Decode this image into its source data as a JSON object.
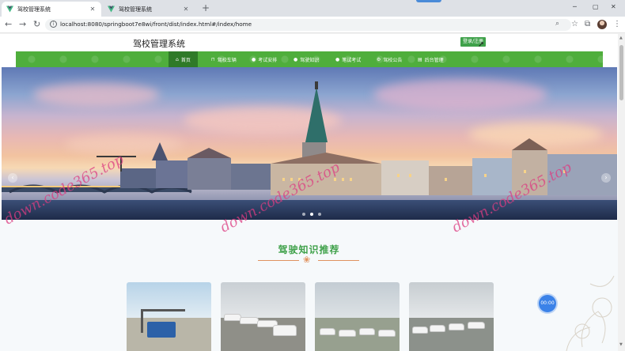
{
  "browser": {
    "tabs": [
      {
        "title": "驾校管理系统",
        "active": true
      },
      {
        "title": "驾校管理系统",
        "active": false
      }
    ],
    "url": "localhost:8080/springboot7e8wi/front/dist/index.html#/index/home",
    "icons": [
      "back-icon",
      "forward-icon",
      "reload-icon",
      "info-icon",
      "zoom-icon",
      "star-icon",
      "extensions-icon",
      "menu-icon"
    ]
  },
  "site": {
    "title": "驾校管理系统",
    "login_label": "登录/注册"
  },
  "nav": {
    "items": [
      {
        "label": "首页",
        "icon": "home-icon",
        "active": true
      },
      {
        "label": "驾校车辆",
        "icon": "car-icon",
        "active": false
      },
      {
        "label": "考试安排",
        "icon": "circle-icon",
        "active": false
      },
      {
        "label": "驾驶知识",
        "icon": "circle-icon",
        "active": false
      },
      {
        "label": "笔试考试",
        "icon": "circle-icon",
        "active": false
      },
      {
        "label": "驾校公告",
        "icon": "settings-icon",
        "active": false
      },
      {
        "label": "后台管理",
        "icon": "admin-icon",
        "active": false
      }
    ],
    "color": "#4fae3c",
    "active_color": "#2f7a28"
  },
  "banner": {
    "slide_count": 3,
    "active_slide": 2
  },
  "section": {
    "title": "驾驶知识推荐",
    "accent": "#3fa14a"
  },
  "watermark": "down.code365.top",
  "timer": "00:00"
}
